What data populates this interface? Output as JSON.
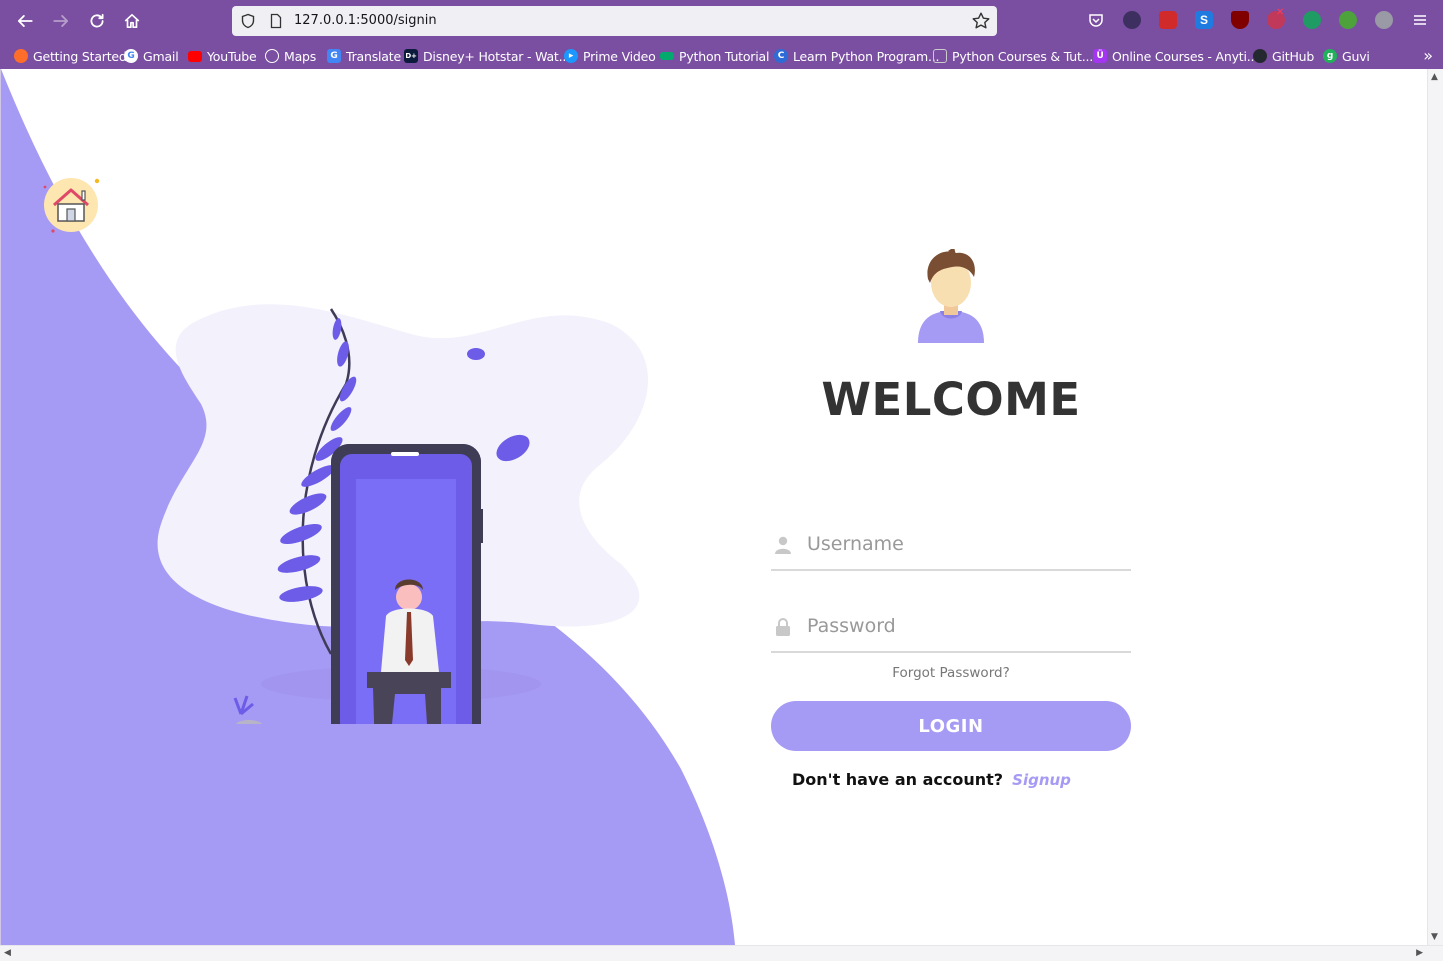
{
  "browser": {
    "url": "127.0.0.1:5000/signin",
    "bookmarks": [
      {
        "label": "Getting Started",
        "icon": "firefox-icon",
        "color": "#ff6d2a"
      },
      {
        "label": "Gmail",
        "icon": "google-icon",
        "color": "#ffffff"
      },
      {
        "label": "YouTube",
        "icon": "youtube-icon",
        "color": "#ff0000"
      },
      {
        "label": "Maps",
        "icon": "globe-icon",
        "color": "#7a4ea0"
      },
      {
        "label": "Translate",
        "icon": "translate-icon",
        "color": "#4285f4"
      },
      {
        "label": "Disney+ Hotstar - Wat...",
        "icon": "hotstar-icon",
        "color": "#0c1b3c"
      },
      {
        "label": "Prime Video",
        "icon": "prime-video-icon",
        "color": "#1a98ff"
      },
      {
        "label": "Python Tutorial",
        "icon": "w3schools-icon",
        "color": "#04aa6d"
      },
      {
        "label": "Learn Python Program...",
        "icon": "programiz-icon",
        "color": "#2e6bd6"
      },
      {
        "label": "Python Courses & Tut...",
        "icon": "course-icon",
        "color": "#555555"
      },
      {
        "label": "Online Courses - Anyti...",
        "icon": "udemy-icon",
        "color": "#a435f0"
      },
      {
        "label": "GitHub",
        "icon": "github-icon",
        "color": "#24292f"
      },
      {
        "label": "Guvi",
        "icon": "guvi-icon",
        "color": "#20b15a"
      }
    ],
    "extension_badge": "✕"
  },
  "page": {
    "welcome": "WELCOME",
    "username_placeholder": "Username",
    "password_placeholder": "Password",
    "forgot": "Forgot Password?",
    "login": "LOGIN",
    "signup_question": "Don't have an account?",
    "signup_link": "Signup"
  },
  "colors": {
    "accent": "#a59af4",
    "toolbar": "#7a4ea0",
    "heading": "#333333"
  }
}
